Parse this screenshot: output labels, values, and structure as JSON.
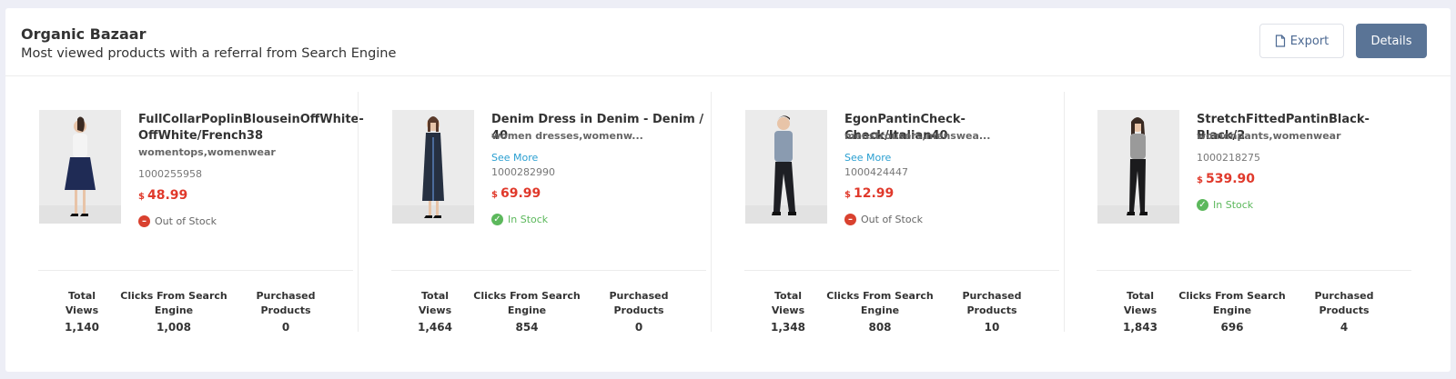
{
  "header": {
    "title": "Organic Bazaar",
    "subtitle": "Most viewed products with a referral from Search Engine",
    "export_label": "Export",
    "details_label": "Details"
  },
  "stat_labels": {
    "views": "Total Views",
    "clicks": "Clicks From Search Engine",
    "purchased": "Purchased Products"
  },
  "currency": "$",
  "see_more": "See More",
  "products": [
    {
      "name": "FullCollarPoplinBlouseinOffWhite-OffWhite/French38",
      "categories": "womentops,womenwear",
      "sku": "1000255958",
      "price": "48.99",
      "stock": "Out of Stock",
      "in_stock": false,
      "views": "1,140",
      "clicks": "1,008",
      "purchased": "0",
      "outfit_top": "#f4f4f4",
      "outfit_bottom": "#1f2b55"
    },
    {
      "name": "Denim Dress in Denim - Denim / 40",
      "categories": "women dresses,womenw...",
      "sku": "1000282990",
      "price": "69.99",
      "stock": "In Stock",
      "in_stock": true,
      "views": "1,464",
      "clicks": "854",
      "purchased": "0",
      "outfit_top": "#263041",
      "outfit_bottom": "#263041"
    },
    {
      "name": "EgonPantinCheck-Check/Italian40",
      "categories": "menstrousers,menswea...",
      "sku": "1000424447",
      "price": "12.99",
      "stock": "Out of Stock",
      "in_stock": false,
      "views": "1,348",
      "clicks": "808",
      "purchased": "10",
      "outfit_top": "#8a9bb0",
      "outfit_bottom": "#1e1f24"
    },
    {
      "name": "StretchFittedPantinBlack-Black/2",
      "categories": "womenpants,womenwear",
      "sku": "1000218275",
      "price": "539.90",
      "stock": "In Stock",
      "in_stock": true,
      "views": "1,843",
      "clicks": "696",
      "purchased": "4",
      "outfit_top": "#9a9a9a",
      "outfit_bottom": "#1b1b1d"
    }
  ]
}
